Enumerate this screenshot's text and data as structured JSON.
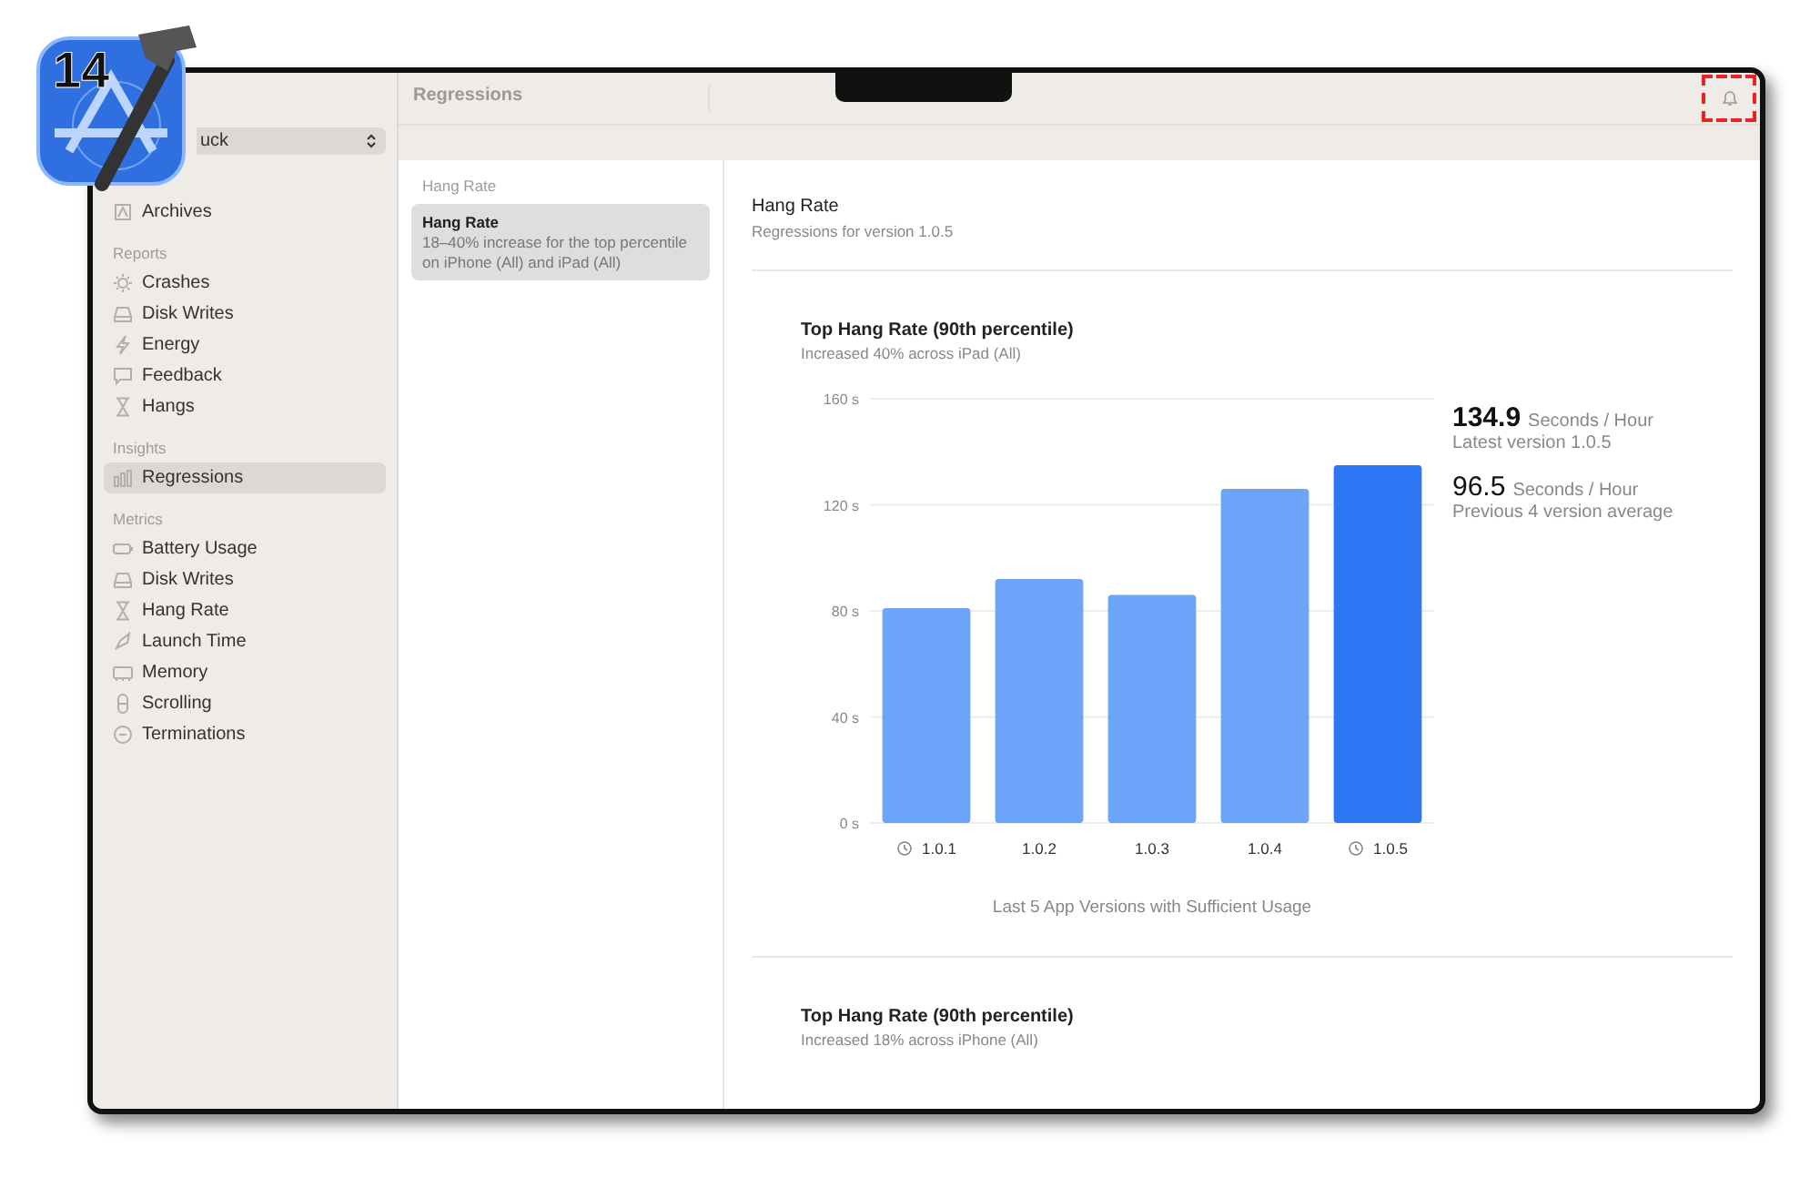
{
  "app_icon": {
    "badge": "14"
  },
  "sidebar": {
    "scheme_picker": {
      "value": "uck"
    },
    "items": [
      {
        "kind": "item",
        "label": "Archives",
        "selected": false
      },
      {
        "kind": "header",
        "label": "Reports"
      },
      {
        "kind": "item",
        "label": "Crashes",
        "selected": false
      },
      {
        "kind": "item",
        "label": "Disk Writes",
        "selected": false
      },
      {
        "kind": "item",
        "label": "Energy",
        "selected": false
      },
      {
        "kind": "item",
        "label": "Feedback",
        "selected": false
      },
      {
        "kind": "item",
        "label": "Hangs",
        "selected": false
      },
      {
        "kind": "header",
        "label": "Insights"
      },
      {
        "kind": "item",
        "label": "Regressions",
        "selected": true
      },
      {
        "kind": "header",
        "label": "Metrics"
      },
      {
        "kind": "item",
        "label": "Battery Usage",
        "selected": false
      },
      {
        "kind": "item",
        "label": "Disk Writes",
        "selected": false
      },
      {
        "kind": "item",
        "label": "Hang Rate",
        "selected": false
      },
      {
        "kind": "item",
        "label": "Launch Time",
        "selected": false
      },
      {
        "kind": "item",
        "label": "Memory",
        "selected": false
      },
      {
        "kind": "item",
        "label": "Scrolling",
        "selected": false
      },
      {
        "kind": "item",
        "label": "Terminations",
        "selected": false
      }
    ]
  },
  "toolbar": {
    "title": "Regressions",
    "bell_highlighted": true
  },
  "regression_list": {
    "section": "Hang Rate",
    "items": [
      {
        "title": "Hang Rate",
        "detail": "18–40% increase for the top percentile on iPhone (All) and iPad (All)",
        "selected": true
      }
    ]
  },
  "detail": {
    "title": "Hang Rate",
    "subtitle": "Regressions for version 1.0.5",
    "cards": [
      {
        "title": "Top Hang Rate (90th percentile)",
        "subtitle": "Increased 40% across iPad (All)",
        "stats": [
          {
            "value": "134.9",
            "unit": "Seconds / Hour",
            "caption": "Latest version 1.0.5",
            "strong": true
          },
          {
            "value": "96.5",
            "unit": "Seconds / Hour",
            "caption": "Previous 4 version average",
            "strong": false
          }
        ],
        "chart_data": {
          "type": "bar",
          "xlabel": "Last 5 App Versions with Sufficient Usage",
          "categories": [
            "1.0.1",
            "1.0.2",
            "1.0.3",
            "1.0.4",
            "1.0.5"
          ],
          "series": [
            {
              "color": "#6ba4f8",
              "values": [
                81,
                92,
                86,
                126,
                null
              ]
            },
            {
              "color": "#2f76f5",
              "values": [
                null,
                null,
                null,
                null,
                134.9
              ]
            }
          ],
          "grid": true,
          "ylim": [
            0,
            160
          ],
          "yticks": [
            {
              "value": 0,
              "label": "0 s"
            },
            {
              "value": 40,
              "label": "40 s"
            },
            {
              "value": 80,
              "label": "80 s"
            },
            {
              "value": 120,
              "label": "120 s"
            },
            {
              "value": 160,
              "label": "160 s"
            }
          ]
        },
        "version_icons": [
          true,
          false,
          false,
          false,
          true
        ]
      },
      {
        "title": "Top Hang Rate (90th percentile)",
        "subtitle": "Increased 18% across iPhone (All)"
      }
    ]
  }
}
